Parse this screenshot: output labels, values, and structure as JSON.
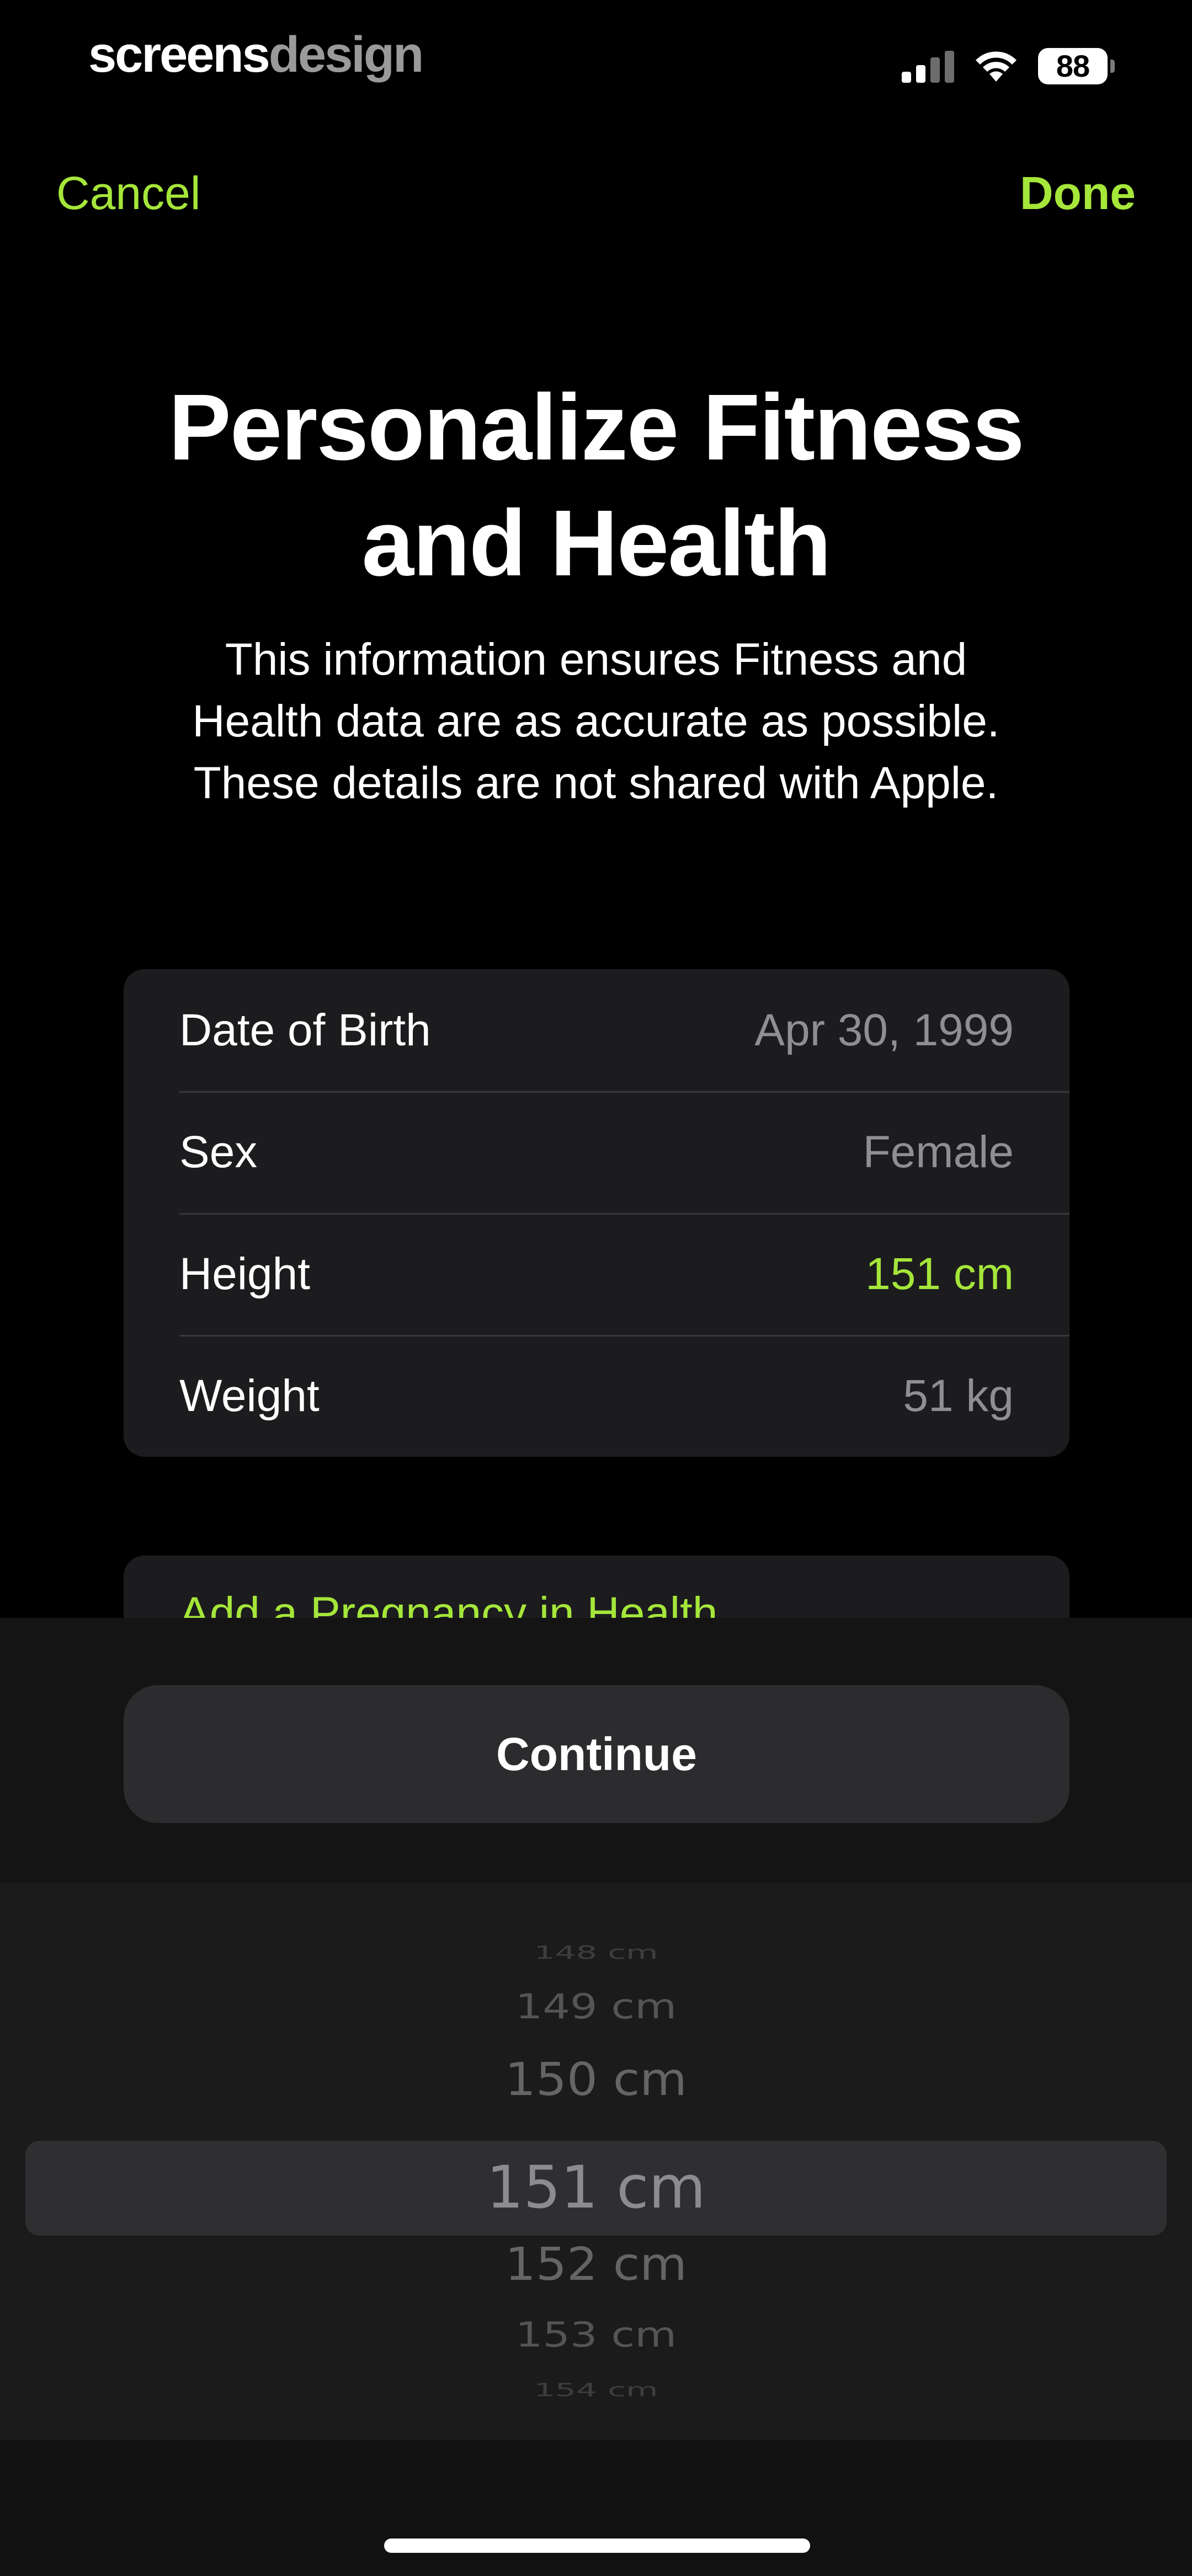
{
  "status_bar": {
    "brand_part1": "screens",
    "brand_part2": "design",
    "battery_level": "88",
    "signal_bars_active": 2,
    "signal_bars_total": 4
  },
  "nav": {
    "cancel_label": "Cancel",
    "done_label": "Done"
  },
  "header": {
    "title_line1": "Personalize Fitness",
    "title_line2": "and Health",
    "subtitle_line1": "This information ensures Fitness and",
    "subtitle_line2": "Health data are as accurate as possible.",
    "subtitle_line3": "These details are not shared with Apple."
  },
  "details": {
    "rows": [
      {
        "label": "Date of Birth",
        "value": "Apr 30, 1999"
      },
      {
        "label": "Sex",
        "value": "Female"
      },
      {
        "label": "Height",
        "value": "151 cm"
      },
      {
        "label": "Weight",
        "value": "51 kg"
      }
    ]
  },
  "pregnancy": {
    "link_label": "Add a Pregnancy in Health"
  },
  "continue_label": "Continue",
  "picker": {
    "items": [
      "148 cm",
      "149 cm",
      "150 cm",
      "151 cm",
      "152 cm",
      "153 cm",
      "154 cm"
    ],
    "selected": "151 cm"
  },
  "colors": {
    "accent": "#a5e63a",
    "background": "#000000",
    "card": "#1c1c1e",
    "secondary_text": "#8e8e93"
  }
}
